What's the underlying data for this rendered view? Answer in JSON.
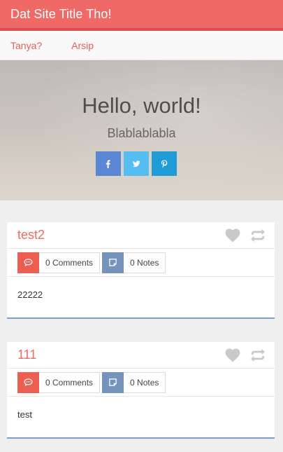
{
  "header": {
    "title": "Dat Site Title Tho!"
  },
  "nav": {
    "items": [
      "Tanya?",
      "Arsip"
    ]
  },
  "hero": {
    "title": "Hello, world!",
    "subtitle": "Blablablabla",
    "social": [
      {
        "icon": "facebook-icon",
        "color": "#5b86d4",
        "glyph": "f"
      },
      {
        "icon": "twitter-icon",
        "color": "#55bdf0",
        "glyph": "t"
      },
      {
        "icon": "pinterest-icon",
        "color": "#1f9bd6",
        "glyph": "p"
      }
    ]
  },
  "posts": [
    {
      "title": "test2",
      "comments": "0 Comments",
      "notes": "0 Notes",
      "body": "22222"
    },
    {
      "title": "111",
      "comments": "0 Comments",
      "notes": "0 Notes",
      "body": "test"
    }
  ],
  "colors": {
    "accent": "#ef6a66",
    "header_border": "#d94f4b",
    "comments_icon_bg": "#ec5d52",
    "notes_icon_bg": "#7693bb",
    "post_border": "#7fa0c8"
  }
}
